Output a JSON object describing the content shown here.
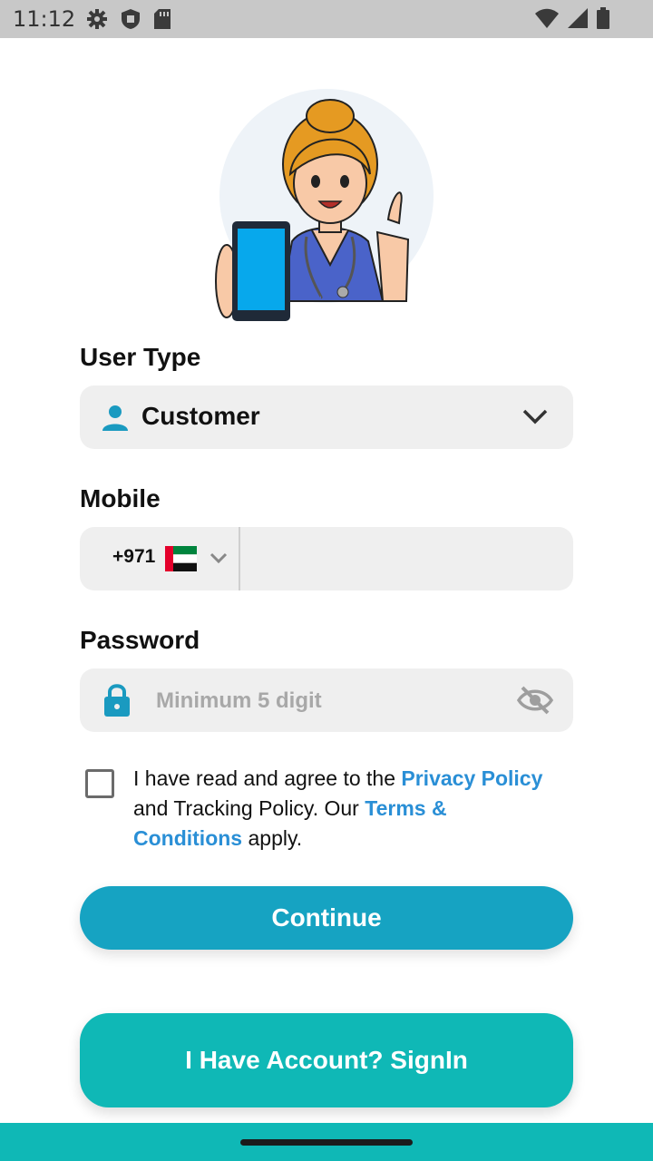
{
  "status_bar": {
    "time": "11:12",
    "left_icons": [
      "gear-icon",
      "shield-icon",
      "sd-card-icon"
    ],
    "right_icons": [
      "wifi-icon",
      "signal-icon",
      "battery-icon"
    ]
  },
  "form": {
    "user_type": {
      "label": "User Type",
      "value": "Customer",
      "icon": "person-icon"
    },
    "mobile": {
      "label": "Mobile",
      "country_code": "+971",
      "country_flag": "uae-flag",
      "value": ""
    },
    "password": {
      "label": "Password",
      "placeholder": "Minimum 5 digit",
      "value": ""
    },
    "agreement": {
      "checked": false,
      "text_1": "I have read and agree to the ",
      "privacy_link": "Privacy Policy",
      "text_2": " and Tracking Policy. Our ",
      "terms_link": "Terms & Conditions",
      "text_3": " apply."
    }
  },
  "buttons": {
    "continue": "Continue",
    "signin": "I Have Account? SignIn"
  },
  "colors": {
    "accent": "#16a3c2",
    "teal": "#0fb8b6",
    "link": "#2a8fd6",
    "field_bg": "#efefef"
  }
}
